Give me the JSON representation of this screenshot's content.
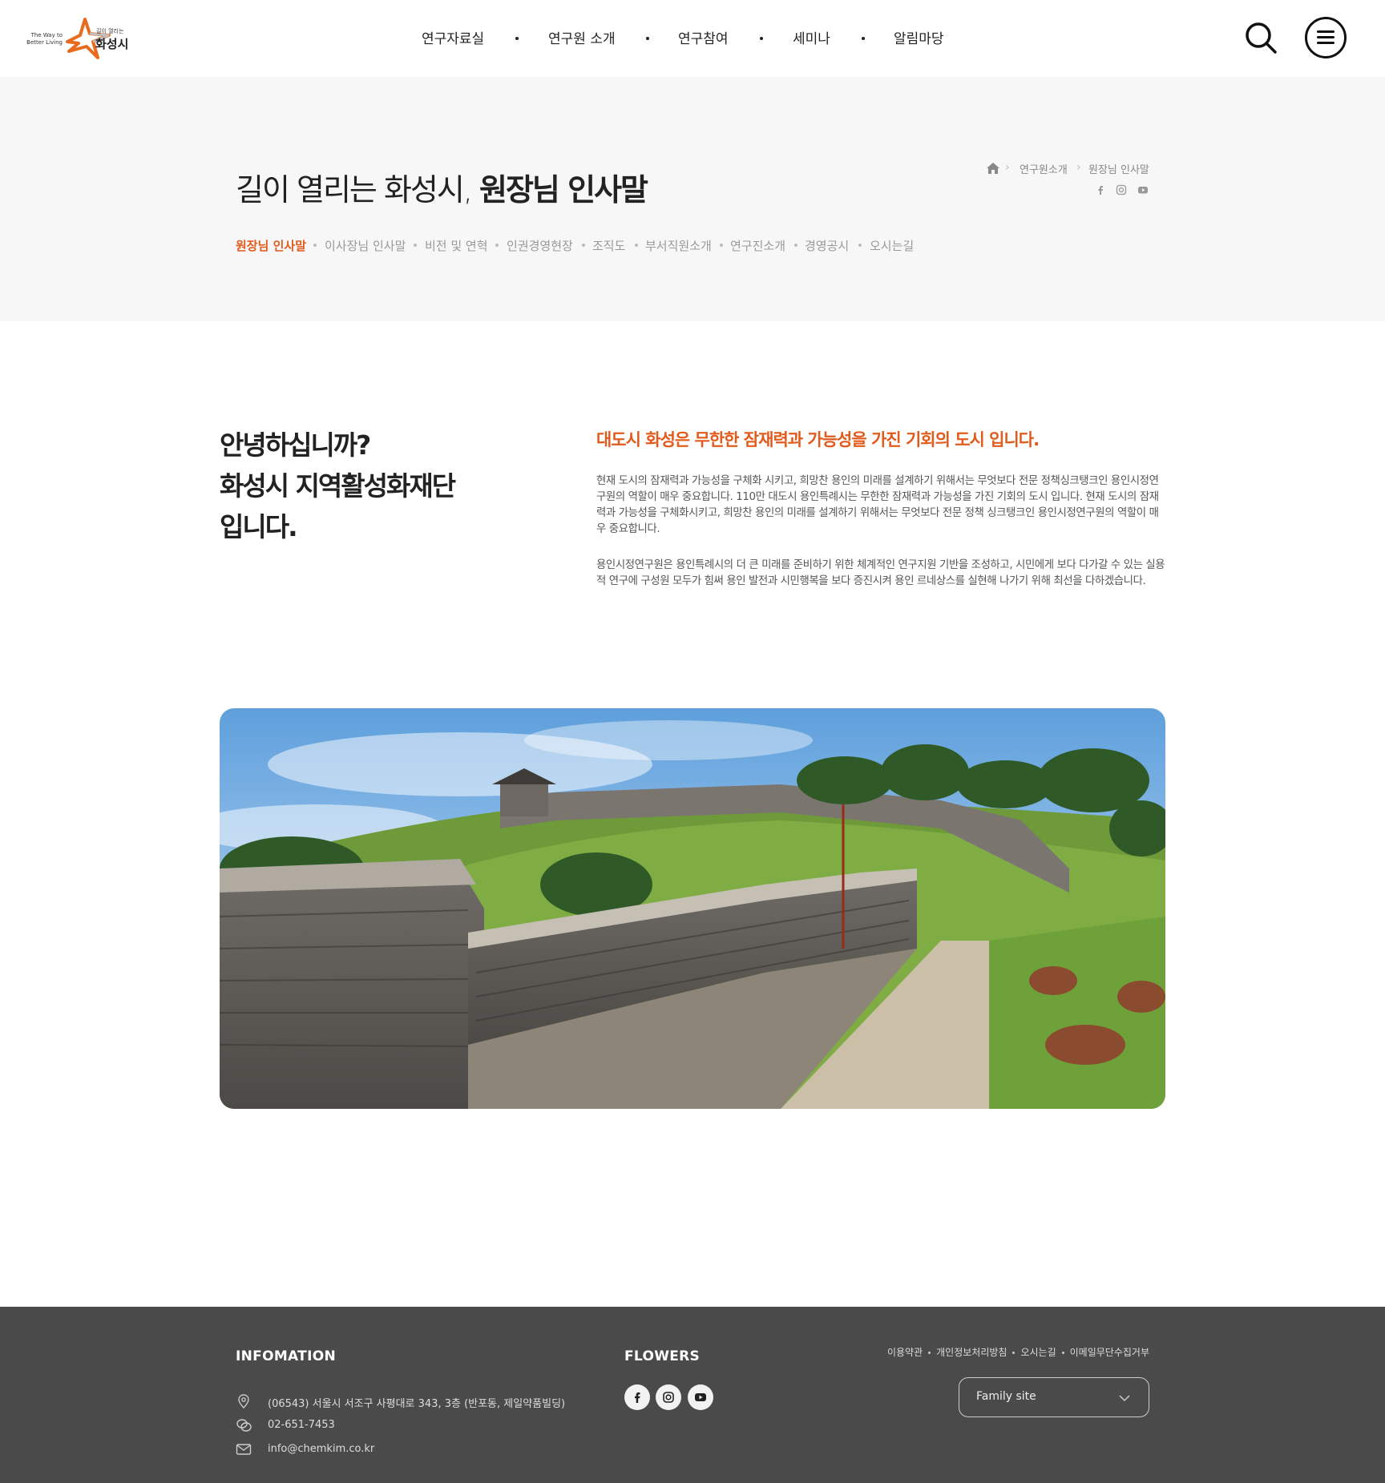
{
  "logo": {
    "tagline_line1": "The Way to",
    "tagline_line2": "Better Living",
    "small_text": "길이 열리는",
    "city": "화성시"
  },
  "nav": {
    "items": [
      "연구자료실",
      "연구원 소개",
      "연구참여",
      "세미나",
      "알림마당"
    ]
  },
  "header_icons": {
    "search": "search-icon",
    "menu": "menu-icon"
  },
  "subvisual": {
    "heading_light": "길이 열리는 화성시,",
    "heading_bold": "원장님 인사말",
    "breadcrumb": [
      "연구원소개",
      "원장님 인사말"
    ],
    "sns": [
      "facebook-icon",
      "instagram-icon",
      "youtube-icon"
    ],
    "tabs": [
      "원장님 인사말",
      "이사장님 인사말",
      "비전 및 연혁",
      "인권경영현장",
      "조직도",
      "부서직원소개",
      "연구진소개",
      "경영공시",
      "오시는길"
    ],
    "active_tab": "원장님 인사말"
  },
  "greeting": {
    "title_lines": [
      "안녕하십니까?",
      "화성시 지역활성화재단",
      "입니다."
    ],
    "lead": "대도시 화성은 무한한 잠재력과 가능성을 가진 기회의 도시 입니다.",
    "paragraph1": "현재 도시의 잠재력과 가능성을 구체화 시키고, 희망찬 용인의 미래를 설계하기 위해서는 무엇보다 전문 정책싱크탱크인 용인시정연구원의 역할이 매우 중요합니다. 110만 대도시 용인특례시는 무한한 잠재력과 가능성을 가진 기회의 도시 입니다. 현재 도시의 잠재력과 가능성을 구체화시키고, 희망찬 용인의 미래를 설계하기 위해서는 무엇보다 전문 정책 싱크탱크인 용인시정연구원의 역할이 매우 중요합니다.",
    "paragraph2": "용인시정연구원은 용인특례시의 더 큰 미래를 준비하기 위한 체계적인 연구지원 기반을 조성하고, 시민에게 보다 다가갈 수 있는 실용적 연구에 구성원 모두가 힘써 용인 발전과 시민행복을 보다 증진시켜 용인 르네상스를 실현해 나가기 위해 최선을 다하겠습니다."
  },
  "footer": {
    "info_title": "INFOMATION",
    "address": "(06543) 서울시 서조구 사평대로 343, 3층 (반포동, 제일약품빌딩)",
    "phone": "02-651-7453",
    "email": "info@chemkim.co.kr",
    "sns_title": "FLOWERS",
    "sns": [
      "facebook-icon",
      "instagram-icon",
      "youtube-icon"
    ],
    "links": [
      "이용약관",
      "개인정보처리방침",
      "오시는길",
      "이메일무단수집거부"
    ],
    "family_site": "Family site"
  },
  "colors": {
    "accent": "#e25a1c",
    "footer_bg": "#4a4a4a",
    "subvisual_bg": "#f7f7f7"
  }
}
